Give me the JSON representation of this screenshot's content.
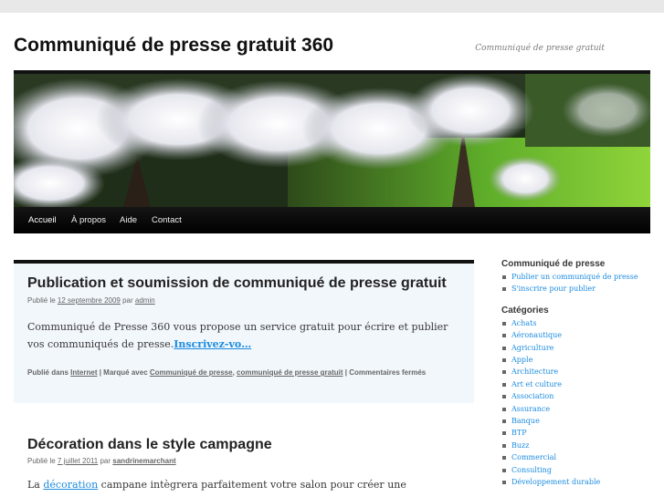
{
  "site": {
    "title": "Communiqué de presse gratuit 360",
    "description": "Communiqué de presse gratuit"
  },
  "nav": {
    "items": [
      {
        "label": "Accueil"
      },
      {
        "label": "À propos"
      },
      {
        "label": "Aide"
      },
      {
        "label": "Contact"
      }
    ]
  },
  "posts": [
    {
      "title": "Publication et soumission de communiqué de presse gratuit",
      "meta_prefix": "Publié le",
      "date": "12 septembre 2009",
      "by": "par",
      "author": "admin",
      "excerpt": "Communiqué de Presse 360 vous propose un service gratuit pour écrire et publier vos communiqués de presse.",
      "more_link": "Inscrivez-vo…",
      "footer_prefix": "Publié dans",
      "category": "Internet",
      "tagged": "| Marqué avec",
      "tags": [
        "Communiqué de presse",
        "communiqué de presse gratuit"
      ],
      "comma": ",",
      "comments": "| Commentaires fermés"
    },
    {
      "title": "Décoration dans le style campagne",
      "meta_prefix": "Publié le",
      "date": "7 juillet 2011",
      "by": "par",
      "author": "sandrinemarchant",
      "excerpt_start": "La",
      "excerpt_link": "décoration",
      "excerpt_rest": "campane intègrera parfaitement votre salon pour créer une ambiance"
    }
  ],
  "sidebar": {
    "widget1": {
      "title": "Communiqué de presse",
      "items": [
        "Publier un communiqué de presse",
        "S'inscrire pour publier"
      ]
    },
    "widget2": {
      "title": "Catégories",
      "items": [
        "Achats",
        "Aéronautique",
        "Agriculture",
        "Apple",
        "Architecture",
        "Art et culture",
        "Association",
        "Assurance",
        "Banque",
        "BTP",
        "Buzz",
        "Commercial",
        "Consulting",
        "Développement durable"
      ]
    }
  },
  "colors": {
    "link": "#1b8be0",
    "sticky_bg": "#f2f7fc",
    "nav_bg": "#000000"
  }
}
